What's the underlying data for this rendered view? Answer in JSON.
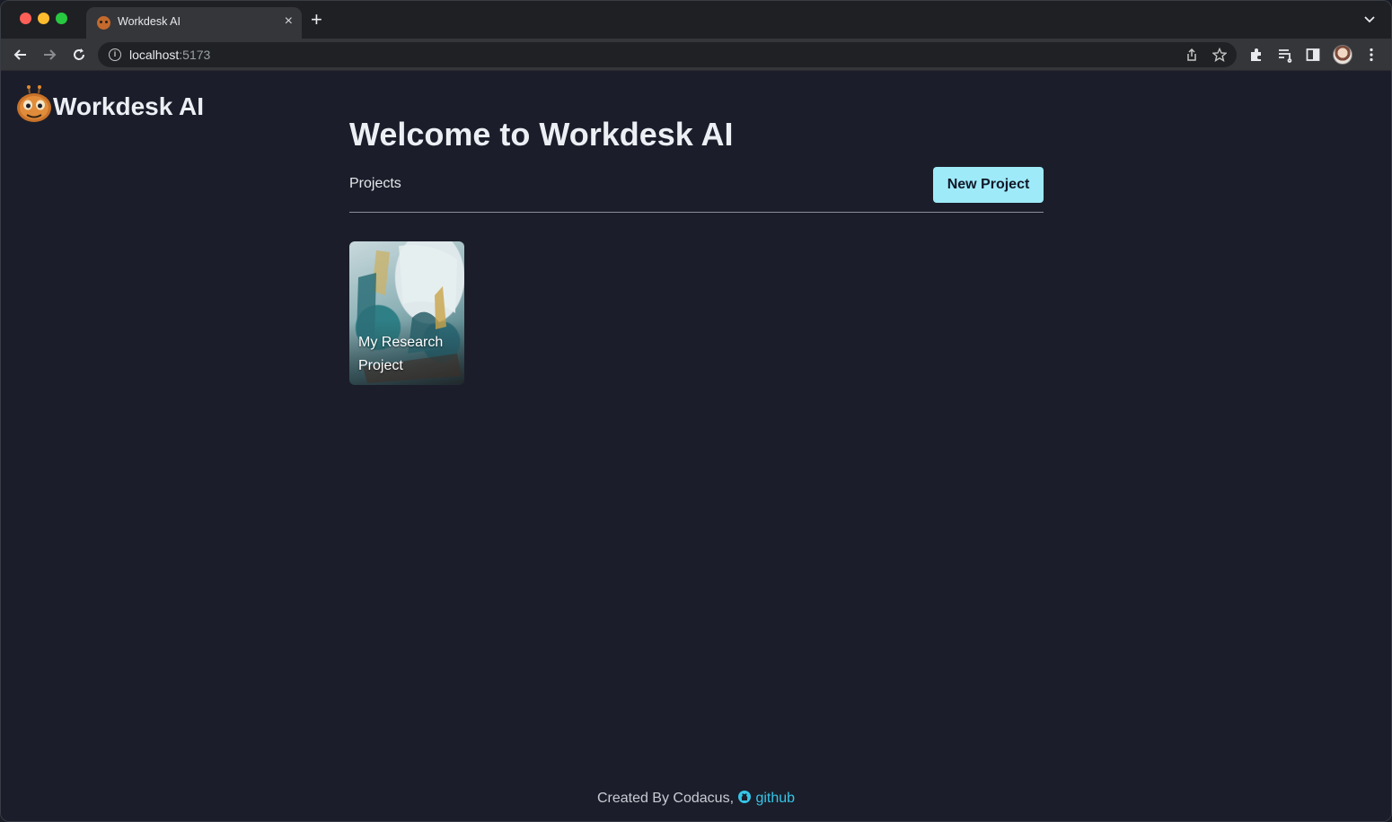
{
  "browser": {
    "tab_title": "Workdesk AI",
    "tab_close": "×",
    "new_tab": "+",
    "url_host": "localhost",
    "url_port": ":5173"
  },
  "app": {
    "brand": "Workdesk AI",
    "heading": "Welcome to Workdesk AI",
    "projects_label": "Projects",
    "new_project_label": "New Project",
    "projects": [
      {
        "title": "My Research Project"
      }
    ]
  },
  "footer": {
    "created_by": "Created By Codacus,",
    "github_label": "github"
  },
  "colors": {
    "page_background": "#1b1e2a",
    "accent_button": "#9eeaf9",
    "link": "#35c5e8"
  },
  "icons": [
    "back-arrow-icon",
    "forward-arrow-icon",
    "reload-icon",
    "info-icon",
    "share-icon",
    "star-icon",
    "extensions-icon",
    "reading-list-icon",
    "side-panel-icon",
    "kebab-menu-icon",
    "github-icon",
    "robot-logo-icon"
  ]
}
